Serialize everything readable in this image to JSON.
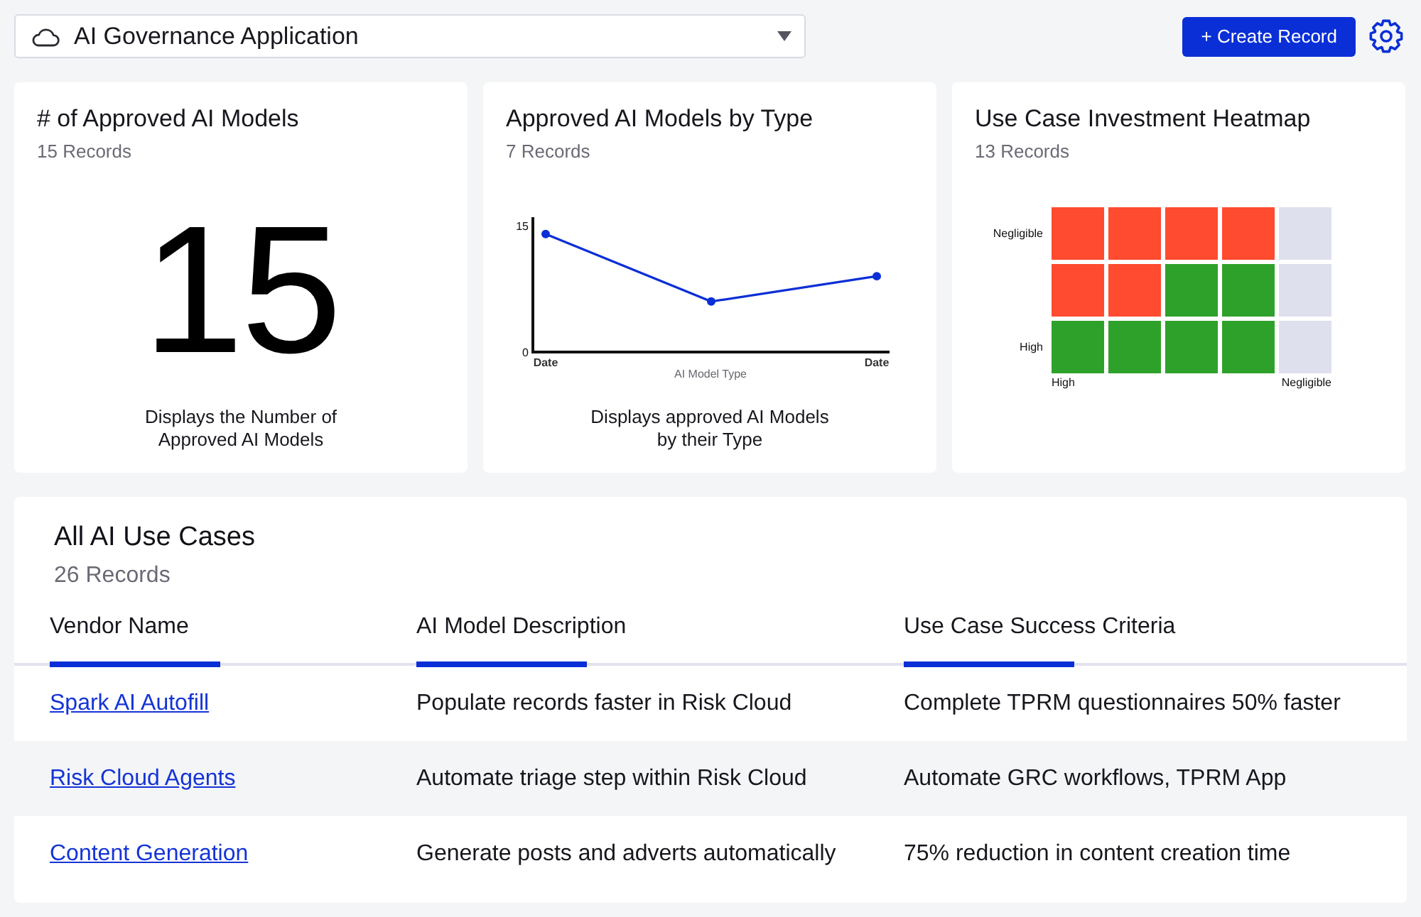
{
  "top_bar": {
    "app_selector": {
      "value": "AI Governance Application"
    },
    "create_button": {
      "label": "+ Create Record"
    }
  },
  "cards": [
    {
      "kind": "metric",
      "title": "# of Approved AI Models",
      "subtitle": "15 Records",
      "value": "15",
      "description": [
        "Displays the Number of",
        "Approved AI Models"
      ]
    },
    {
      "kind": "line_chart",
      "title": "Approved AI Models by Type",
      "subtitle": "7 Records",
      "chart_data": {
        "type": "line",
        "xlabel": "AI Model Type",
        "categories": [
          "Date",
          null,
          "Date"
        ],
        "ylim": [
          0,
          16
        ],
        "yticks": [
          0,
          15
        ],
        "series": [
          {
            "color": "#0a2fd6",
            "marker": "circle",
            "values": [
              14,
              6,
              9
            ]
          }
        ]
      },
      "description": [
        "Displays approved AI Models",
        "by their Type"
      ]
    },
    {
      "kind": "heatmap",
      "title": "Use Case Investment Heatmap",
      "subtitle": "13 Records",
      "heatmap": {
        "rows": [
          {
            "label": "Negligible",
            "cells": [
              {
                "color": "#ff4b2f"
              },
              {
                "color": "#ff4b2f"
              },
              {
                "color": "#ff4b2f"
              },
              {
                "color": "#ff4b2f"
              },
              {
                "color": "#dfe0ee"
              }
            ]
          },
          {
            "cells": [
              {
                "color": "#ff4b2f"
              },
              {
                "color": "#ff4b2f"
              },
              {
                "color": "#2ea12a"
              },
              {
                "color": "#2ea12a"
              },
              {
                "color": "#dfe0ee"
              }
            ]
          },
          {
            "label": "High",
            "cells": [
              {
                "color": "#2ea12a"
              },
              {
                "color": "#2ea12a"
              },
              {
                "color": "#2ea12a"
              },
              {
                "color": "#2ea12a"
              },
              {
                "color": "#dfe0ee"
              }
            ]
          }
        ],
        "x_start_label": "High",
        "x_end_label": "Negligible"
      }
    }
  ],
  "use_cases": {
    "title": "All AI Use Cases",
    "subtitle": "26 Records",
    "columns": [
      "Vendor Name",
      "AI Model Description",
      "Use Case Success Criteria"
    ],
    "rows": [
      {
        "vendor": "Spark AI Autofill",
        "description": "Populate records faster in Risk Cloud",
        "criteria": "Complete TPRM questionnaires 50% faster"
      },
      {
        "vendor": "Risk Cloud Agents",
        "description": "Automate triage step within Risk Cloud",
        "criteria": "Automate GRC workflows, TPRM App"
      },
      {
        "vendor": "Content Generation",
        "description": "Generate posts and adverts automatically",
        "criteria": "75% reduction in content creation time"
      }
    ]
  }
}
